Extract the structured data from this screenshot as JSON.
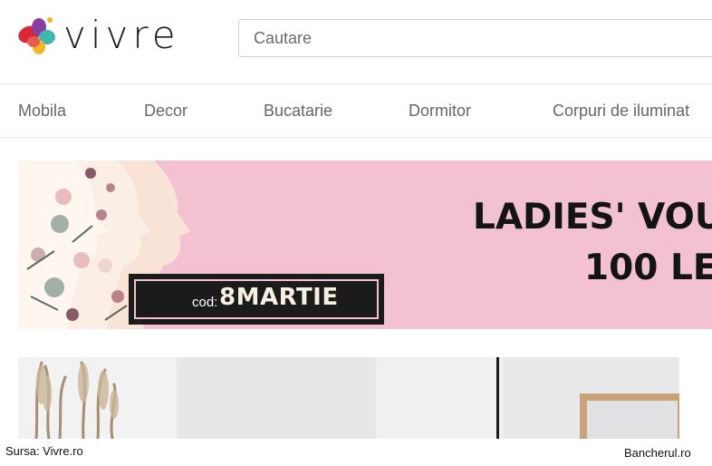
{
  "header": {
    "logo_text": "vivre",
    "search": {
      "placeholder": "Cautare"
    }
  },
  "nav": {
    "items": [
      {
        "label": "Mobila"
      },
      {
        "label": "Decor"
      },
      {
        "label": "Bucatarie"
      },
      {
        "label": "Dormitor"
      },
      {
        "label": "Corpuri de iluminat"
      }
    ]
  },
  "banner": {
    "headline": "LADIES' VOU",
    "subline": "100 LE",
    "code_label": "cod:",
    "code_value": "8MARTIE",
    "background_color": "#f2c2d1"
  },
  "footer": {
    "source": "Sursa: Vivre.ro",
    "credit": "Bancherul.ro"
  },
  "colors": {
    "logo_red": "#d8283a",
    "logo_purple": "#8a3ea0",
    "logo_teal": "#3fb7b0",
    "logo_yellow": "#f2b62c",
    "text_dark": "#141414"
  }
}
